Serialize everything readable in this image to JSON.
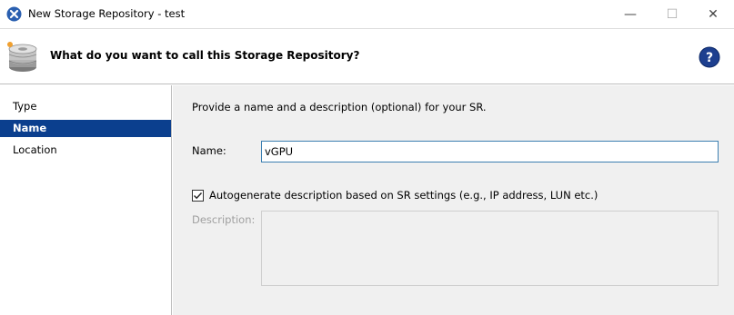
{
  "window": {
    "title": "New Storage Repository - test",
    "controls": {
      "minimize": "—",
      "maximize": "☐",
      "close": "✕"
    },
    "icon": "xenserver-icon"
  },
  "header": {
    "title": "What do you want to call this Storage Repository?",
    "icon": "storage-disk-icon",
    "help_icon": "help-icon",
    "help_glyph": "?"
  },
  "nav": {
    "items": [
      {
        "label": "Type",
        "selected": false
      },
      {
        "label": "Name",
        "selected": true
      },
      {
        "label": "Location",
        "selected": false
      }
    ]
  },
  "main": {
    "intro": "Provide a name and a description (optional) for your SR.",
    "name_label": "Name:",
    "name_value": "vGPU",
    "autogen_label": "Autogenerate description based on SR settings (e.g., IP address, LUN etc.)",
    "autogen_checked": true,
    "description_label": "Description:",
    "description_value": ""
  },
  "colors": {
    "nav_selected": "#0b3f8e",
    "input_border": "#3c7fb1",
    "panel_bg": "#f0f0f0"
  }
}
